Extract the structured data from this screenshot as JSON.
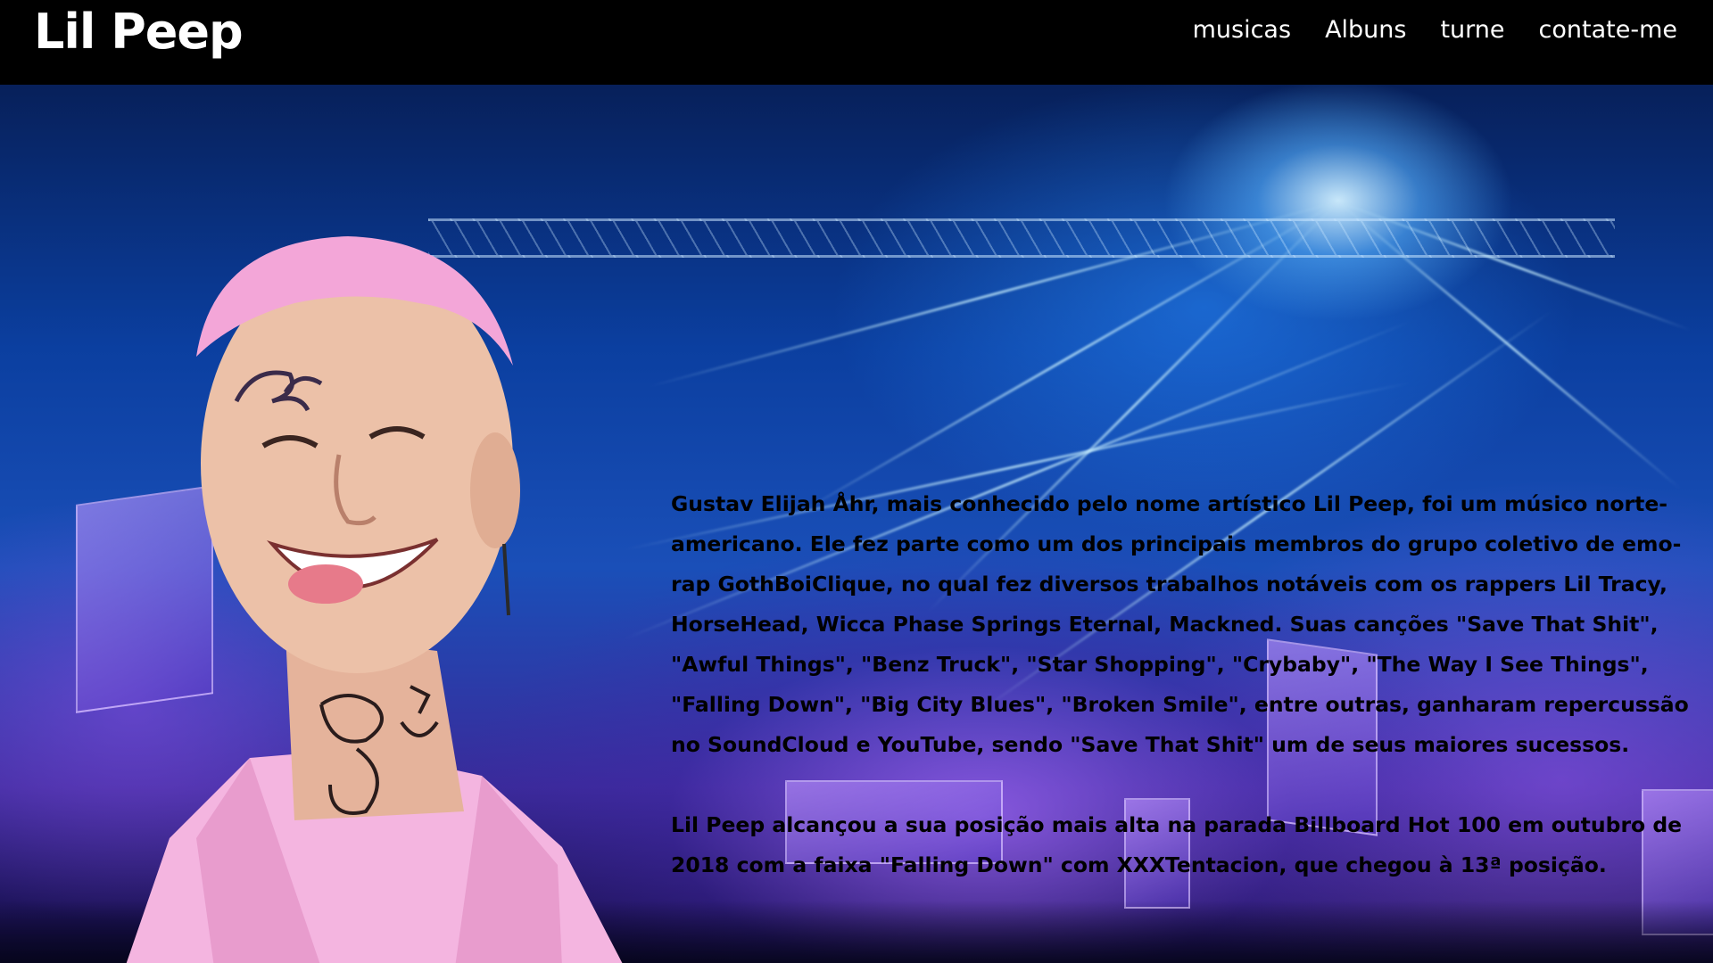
{
  "navbar": {
    "logo": "Lil Peep",
    "links": [
      {
        "label": "musicas"
      },
      {
        "label": "Albuns"
      },
      {
        "label": "turne"
      },
      {
        "label": "contate-me"
      }
    ]
  },
  "hero": {
    "background": "concert-stage-photo",
    "portrait": "artist-portrait-photo",
    "colors": {
      "accent_blue": "#1a4fb8",
      "accent_purple": "#6a3ad0",
      "hair_pink": "#f3a6d8",
      "jacket_pink": "#f6b6e2"
    }
  },
  "bio": {
    "paragraph_1": "Gustav Elijah Åhr, mais conhecido pelo nome artístico Lil Peep, foi um músico norte-americano. Ele fez parte como um dos principais membros do grupo coletivo de emo-rap GothBoiClique, no qual fez diversos trabalhos notáveis com os rappers Lil Tracy, HorseHead, Wicca Phase Springs Eternal, Mackned. Suas canções \"Save That Shit\", \"Awful Things\", \"Benz Truck\", \"Star Shopping\", \"Crybaby\", \"The Way I See Things\", \"Falling Down\", \"Big City Blues\", \"Broken Smile\", entre outras, ganharam repercussão no SoundCloud e YouTube, sendo \"Save That Shit\" um de seus maiores sucessos.",
    "paragraph_2": "Lil Peep alcançou a sua posição mais alta na parada Billboard Hot 100 em outubro de 2018 com a faixa \"Falling Down\" com XXXTentacion, que chegou à 13ª posição."
  }
}
